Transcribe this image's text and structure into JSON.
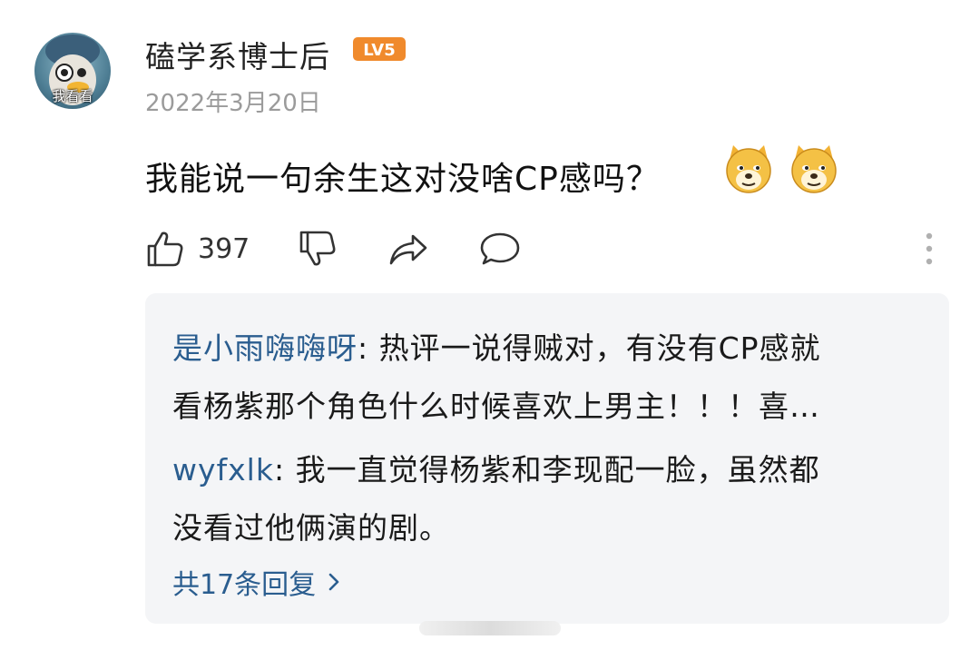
{
  "post": {
    "avatar_caption": "我看看",
    "username": "磕学系博士后",
    "level_badge": "LV5",
    "date": "2022年3月20日",
    "comment_text": "我能说一句余生这对没啥CP感吗？",
    "emojis": [
      "doge-emoji",
      "doge-emoji"
    ],
    "actions": {
      "like_count": "397",
      "icons": [
        "thumbs-up-icon",
        "thumbs-down-icon",
        "share-icon",
        "comment-icon",
        "more-vertical-icon"
      ]
    }
  },
  "replies": {
    "items": [
      {
        "name": "是小雨嗨嗨呀",
        "separator": ": ",
        "line1": "热评一说得贼对，有没有CP感就",
        "line2": "看杨紫那个角色什么时候喜欢上男主！！！喜…"
      },
      {
        "name": "wyfxlk",
        "separator": ": ",
        "line1": "我一直觉得杨紫和李现配一脸，虽然都",
        "line2": "没看过他俩演的剧。"
      }
    ],
    "more_label": "共17条回复"
  },
  "colors": {
    "link": "#2a5d8f",
    "badge": "#f08a2c",
    "reply_bg": "#f4f5f7",
    "date": "#9b9b9b"
  }
}
